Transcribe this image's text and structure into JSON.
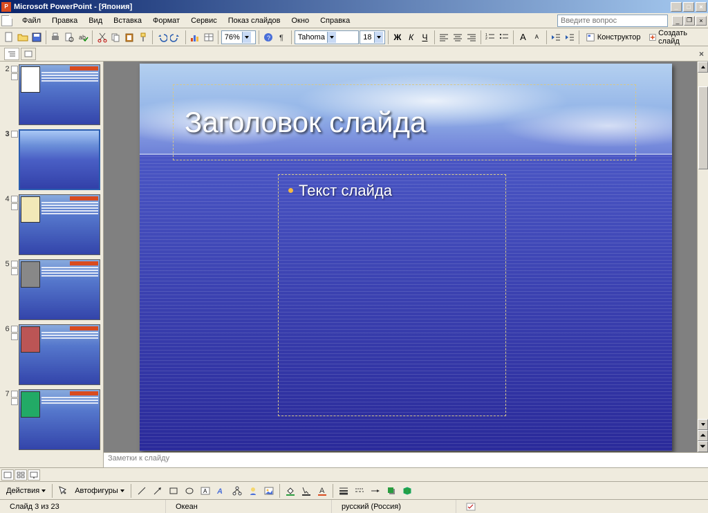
{
  "titlebar": {
    "app_name": "Microsoft PowerPoint",
    "doc_name": "[Япония]"
  },
  "menu": {
    "file": "Файл",
    "edit": "Правка",
    "view": "Вид",
    "insert": "Вставка",
    "format": "Формат",
    "tools": "Сервис",
    "slideshow": "Показ слайдов",
    "window": "Окно",
    "help": "Справка"
  },
  "help_prompt": "Введите вопрос",
  "toolbar": {
    "zoom": "76%",
    "font": "Tahoma",
    "font_size": "18",
    "designer": "Конструктор",
    "new_slide": "Создать слайд"
  },
  "thumbnails": {
    "numbers": [
      "2",
      "3",
      "4",
      "5",
      "6",
      "7"
    ],
    "selected_index": 1
  },
  "slide": {
    "title_placeholder": "Заголовок слайда",
    "body_placeholder": "Текст слайда"
  },
  "notes_placeholder": "Заметки к слайду",
  "draw": {
    "actions": "Действия",
    "autoshapes": "Автофигуры"
  },
  "status": {
    "slide_pos": "Слайд 3 из 23",
    "template": "Океан",
    "language": "русский (Россия)"
  }
}
